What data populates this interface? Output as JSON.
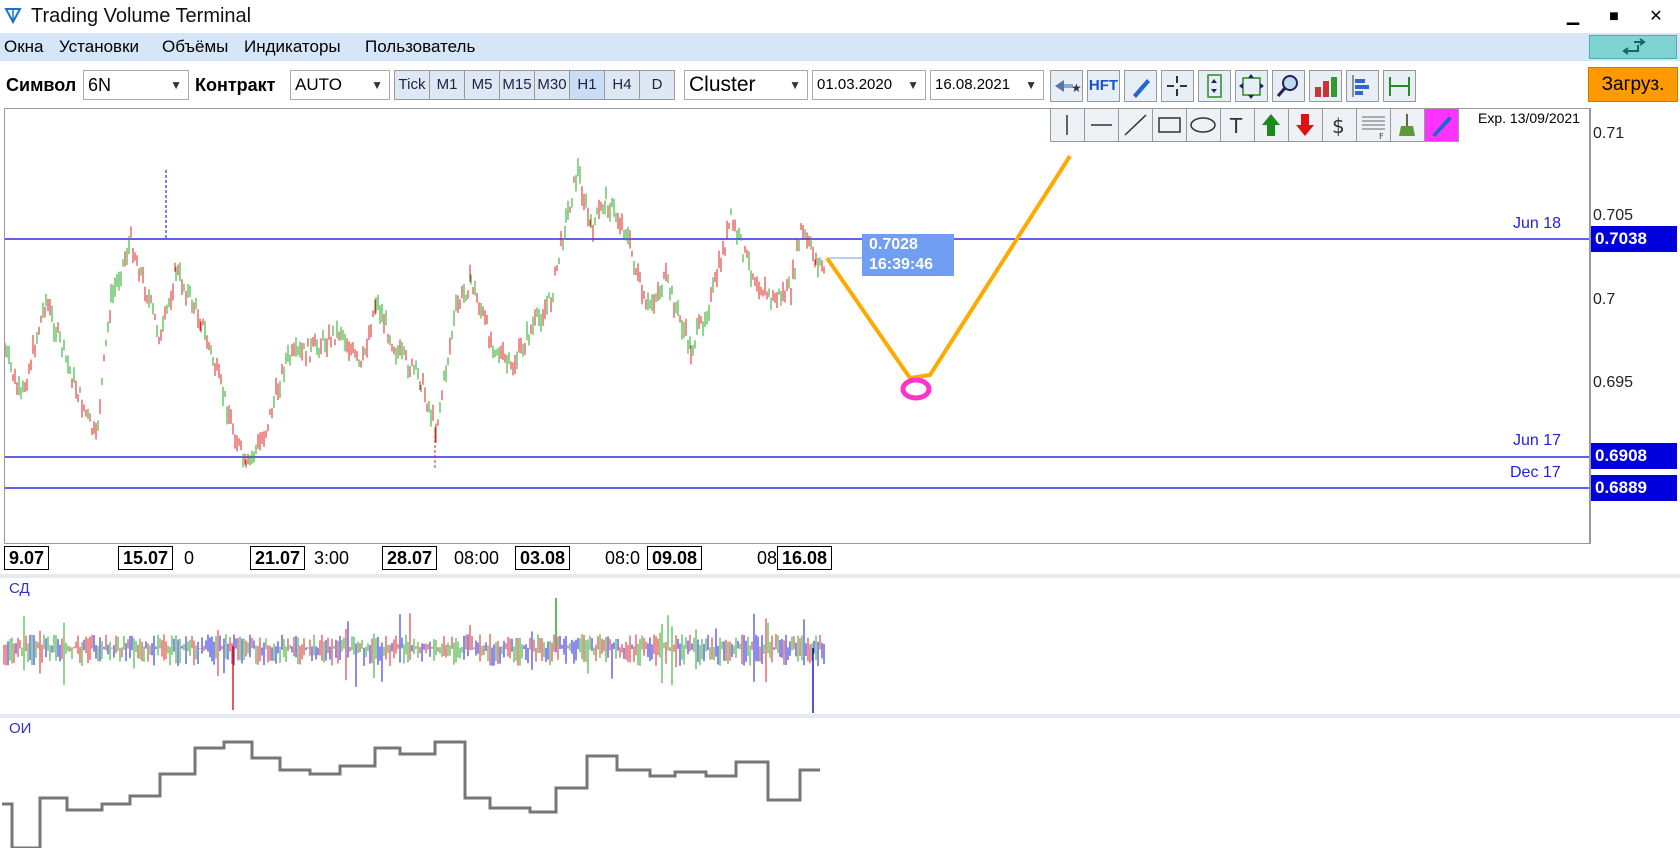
{
  "window": {
    "title": "Trading Volume Terminal",
    "minimize": "▁",
    "maximize": "■",
    "close": "✕"
  },
  "menu": {
    "items": [
      "Окна",
      "Установки",
      "Объёмы",
      "Индикаторы",
      "Пользователь"
    ]
  },
  "toolbar": {
    "symbol_label": "Символ",
    "symbol_value": "6N",
    "contract_label": "Контракт",
    "contract_value": "AUTO",
    "timeframes": [
      "Tick",
      "M1",
      "M5",
      "M15",
      "M30",
      "H1",
      "H4",
      "D"
    ],
    "active_timeframe": "H1",
    "chart_type": "Cluster",
    "date_from": "01.03.2020",
    "date_to": "16.08.2021",
    "hft_label": "HFT",
    "load_label": "Загруз."
  },
  "chart": {
    "expiry": "Exp. 13/09/2021",
    "yticks": [
      "0.71",
      "0.705",
      "0.7",
      "0.695"
    ],
    "levels": [
      {
        "name": "Jun 18",
        "value": "0.7038"
      },
      {
        "name": "Jun 17",
        "value": "0.6908"
      },
      {
        "name": "Dec 17",
        "value": "0.6889"
      }
    ],
    "cursor_price": "0.7028",
    "cursor_time": "16:39:46",
    "xdates": [
      "9.07",
      "15.07",
      "21.07",
      "28.07",
      "03.08",
      "09.08",
      "16.08"
    ],
    "xtimes": [
      "0",
      "3:00",
      "08:00",
      "08:0",
      "08"
    ],
    "colors": {
      "level": "#0000dd",
      "bull": "#22aa22",
      "bear": "#dd2222",
      "projection": "#ffaa00",
      "target": "#ff33cc"
    }
  },
  "panels": {
    "delta_label": "СД",
    "oi_label": "ОИ"
  }
}
